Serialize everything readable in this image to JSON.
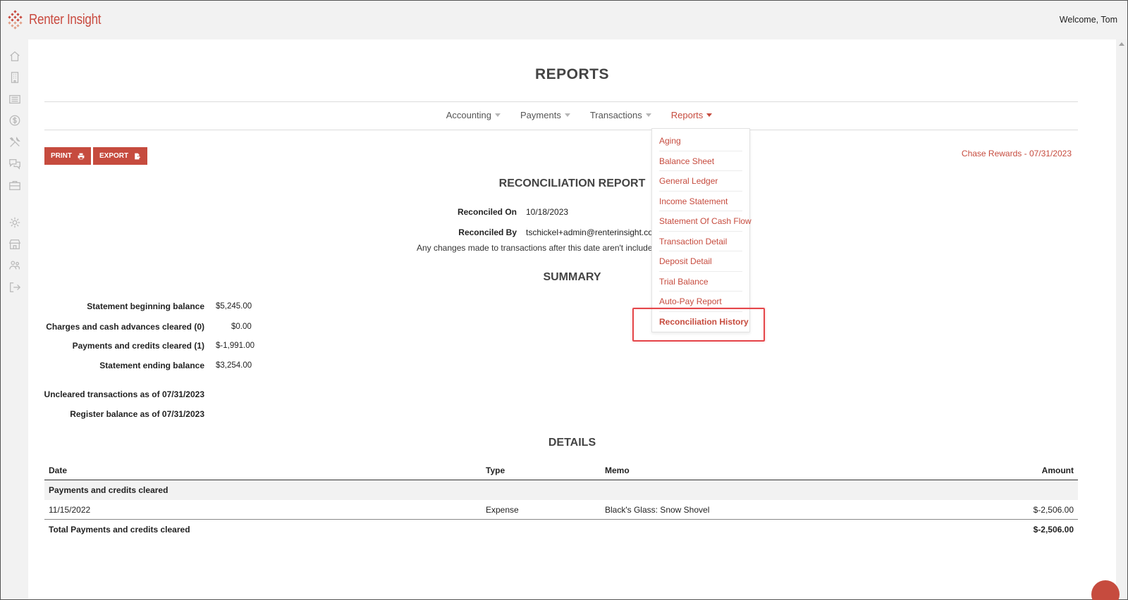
{
  "app": {
    "brand": "Renter Insight",
    "welcome": "Welcome, Tom",
    "accent": "#c64b3e"
  },
  "sidebar": {
    "icons": [
      "home-icon",
      "building-icon",
      "list-icon",
      "dollar-icon",
      "tools-icon",
      "chat-icon",
      "briefcase-icon",
      "gear-icon",
      "store-icon",
      "users-icon",
      "logout-icon"
    ]
  },
  "page": {
    "title": "REPORTS"
  },
  "tabs": [
    {
      "label": "Accounting"
    },
    {
      "label": "Payments"
    },
    {
      "label": "Transactions"
    },
    {
      "label": "Reports",
      "active": true
    }
  ],
  "reports_menu": [
    "Aging",
    "Balance Sheet",
    "General Ledger",
    "Income Statement",
    "Statement Of Cash Flow",
    "Transaction Detail",
    "Deposit Detail",
    "Trial Balance",
    "Auto-Pay Report",
    "Reconciliation History"
  ],
  "toolbar": {
    "print_label": "PRINT",
    "export_label": "EXPORT"
  },
  "account_link": "Chase Rewards - 07/31/2023",
  "report": {
    "title": "RECONCILIATION REPORT",
    "reconciled_on_label": "Reconciled On",
    "reconciled_on": "10/18/2023",
    "reconciled_by_label": "Reconciled By",
    "reconciled_by": "tschickel+admin@renterinsight.co",
    "note": "Any changes made to transactions after this date aren't included"
  },
  "summary": {
    "title": "SUMMARY",
    "rows": [
      {
        "label": "Statement beginning balance",
        "value": "$5,245.00"
      },
      {
        "label": "Charges and cash advances cleared (0)",
        "value": "$0.00"
      },
      {
        "label": "Payments and credits cleared (1)",
        "value": "$-1,991.00"
      },
      {
        "label": "Statement ending balance",
        "value": "$3,254.00"
      }
    ],
    "uncleared_label": "Uncleared transactions as of 07/31/2023",
    "register_label": "Register balance as of 07/31/2023"
  },
  "details": {
    "title": "DETAILS",
    "columns": {
      "date": "Date",
      "type": "Type",
      "memo": "Memo",
      "amount": "Amount"
    },
    "group_label": "Payments and credits cleared",
    "rows": [
      {
        "date": "11/15/2022",
        "type": "Expense",
        "memo": "Black's Glass: Snow Shovel",
        "amount": "$-2,506.00"
      }
    ],
    "total_label": "Total Payments and credits cleared",
    "total_amount": "$-2,506.00"
  }
}
